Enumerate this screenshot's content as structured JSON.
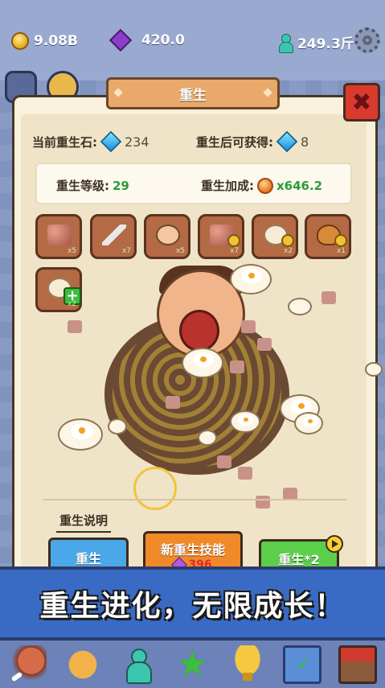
{
  "top_bar": {
    "coins": "9.08B",
    "gems": "420.0",
    "weight": "249.3斤"
  },
  "panel": {
    "title": "重生",
    "current_stone_label": "当前重生石:",
    "current_stone_value": "234",
    "after_rebirth_label": "重生后可获得:",
    "after_rebirth_value": "8",
    "rebirth_level_label": "重生等级:",
    "rebirth_level_value": "29",
    "rebirth_bonus_label": "重生加成:",
    "rebirth_bonus_value": "x646.2"
  },
  "skills": [
    {
      "icon": "meat-cubes-icon",
      "count": "x5"
    },
    {
      "icon": "cleaver-icon",
      "count": "x7"
    },
    {
      "icon": "tap-hand-icon",
      "count": "x5"
    },
    {
      "icon": "meat-cubes-coin-icon",
      "count": "x7"
    },
    {
      "icon": "bun-coin-icon",
      "count": "x2"
    },
    {
      "icon": "roast-chicken-coin-icon",
      "count": "x1"
    },
    {
      "icon": "dumpling-plus-icon",
      "count": "x2"
    }
  ],
  "description_label": "重生说明",
  "buttons": {
    "rebirth": "重生",
    "new_skill": "新重生技能",
    "new_skill_cost": "396",
    "double_rebirth": "重生*2"
  },
  "slogan": "重生进化，无限成长！",
  "nav_items": [
    "meat-icon",
    "fist-icon",
    "character-icon",
    "star-icon",
    "trophy-icon",
    "clipboard-icon",
    "shop-icon"
  ],
  "colors": {
    "rebirth_button": "#4aa8e8",
    "skill_button": "#f08a28",
    "double_button": "#5ccf4a",
    "close_button": "#d93a2e",
    "slogan_band": "#3a6bc4",
    "level_green": "#2f9a3a"
  }
}
